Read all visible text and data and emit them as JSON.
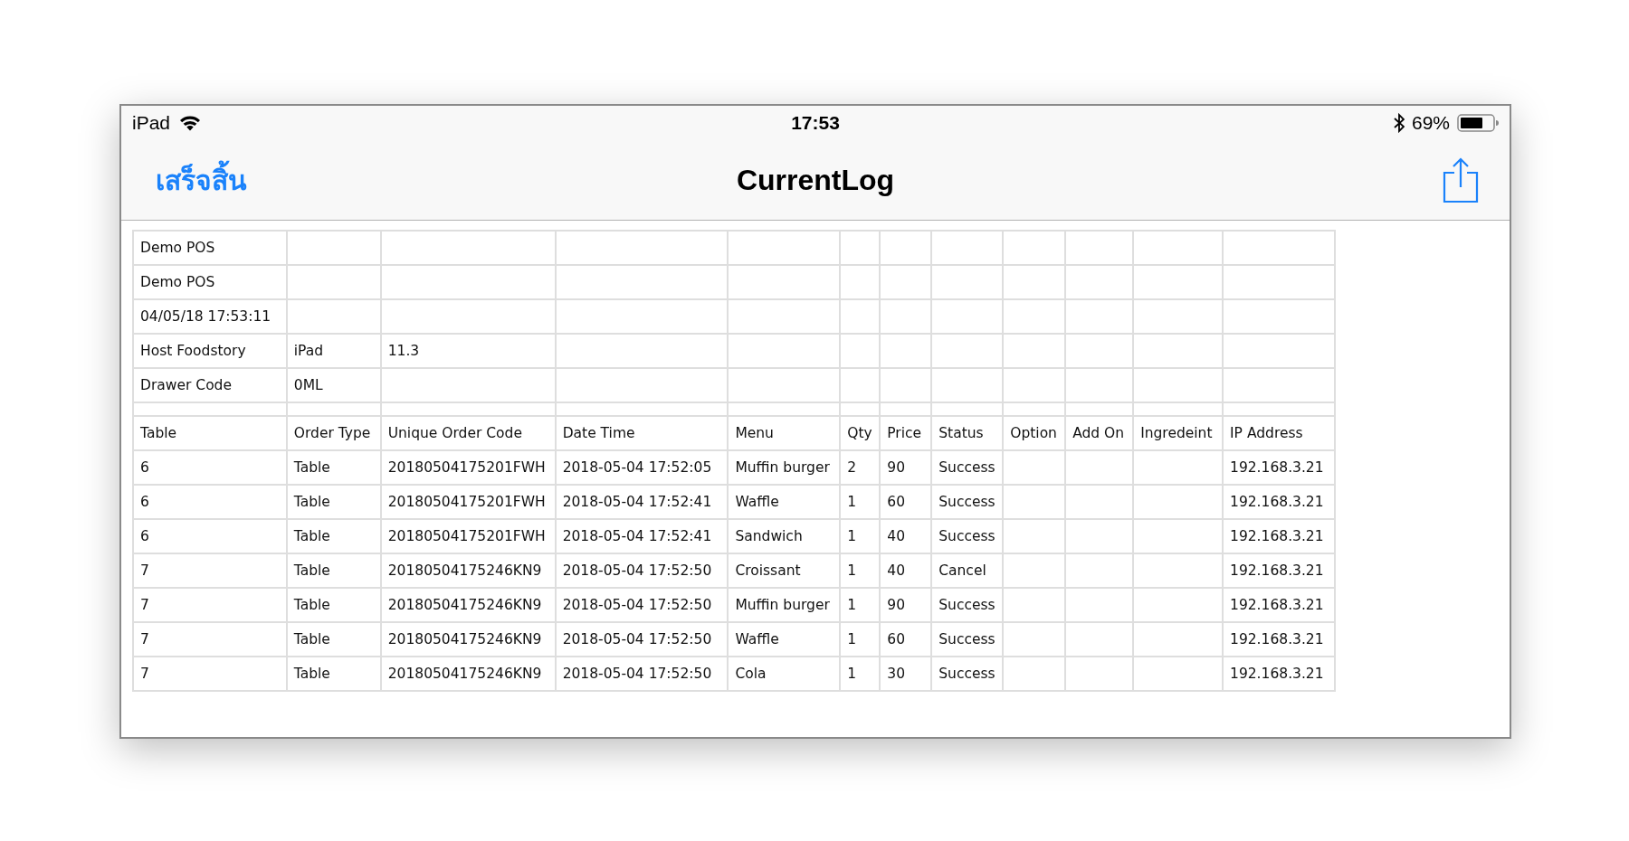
{
  "status_bar": {
    "device": "iPad",
    "time": "17:53",
    "battery": "69%"
  },
  "nav_bar": {
    "back_button": "เสร็จสิ้น",
    "title": "CurrentLog"
  },
  "table": {
    "columns": [
      "Table",
      "Order Type",
      "Unique Order Code",
      "Date Time",
      "Menu",
      "Qty",
      "Price",
      "Status",
      "Option",
      "Add On",
      "Ingredeint",
      "IP Address"
    ],
    "info_rows": [
      [
        "Demo POS"
      ],
      [
        "Demo POS"
      ],
      [
        "04/05/18 17:53:11"
      ],
      [
        "Host Foodstory",
        "iPad",
        "11.3"
      ],
      [
        "Drawer Code",
        "0ML"
      ]
    ],
    "rows": [
      [
        "6",
        "Table",
        "20180504175201FWH",
        "2018-05-04 17:52:05",
        "Muffin burger",
        "2",
        "90",
        "Success",
        null,
        null,
        null,
        "192.168.3.21"
      ],
      [
        "6",
        "Table",
        "20180504175201FWH",
        "2018-05-04 17:52:41",
        "Waffle",
        "1",
        "60",
        "Success",
        null,
        null,
        null,
        "192.168.3.21"
      ],
      [
        "6",
        "Table",
        "20180504175201FWH",
        "2018-05-04 17:52:41",
        "Sandwich",
        "1",
        "40",
        "Success",
        null,
        null,
        null,
        "192.168.3.21"
      ],
      [
        "7",
        "Table",
        "20180504175246KN9",
        "2018-05-04 17:52:50",
        "Croissant",
        "1",
        "40",
        "Cancel",
        null,
        null,
        null,
        "192.168.3.21"
      ],
      [
        "7",
        "Table",
        "20180504175246KN9",
        "2018-05-04 17:52:50",
        "Muffin burger",
        "1",
        "90",
        "Success",
        null,
        null,
        null,
        "192.168.3.21"
      ],
      [
        "7",
        "Table",
        "20180504175246KN9",
        "2018-05-04 17:52:50",
        "Waffle",
        "1",
        "60",
        "Success",
        null,
        null,
        null,
        "192.168.3.21"
      ],
      [
        "7",
        "Table",
        "20180504175246KN9",
        "2018-05-04 17:52:50",
        "Cola",
        "1",
        "30",
        "Success",
        null,
        null,
        null,
        "192.168.3.21"
      ]
    ]
  }
}
